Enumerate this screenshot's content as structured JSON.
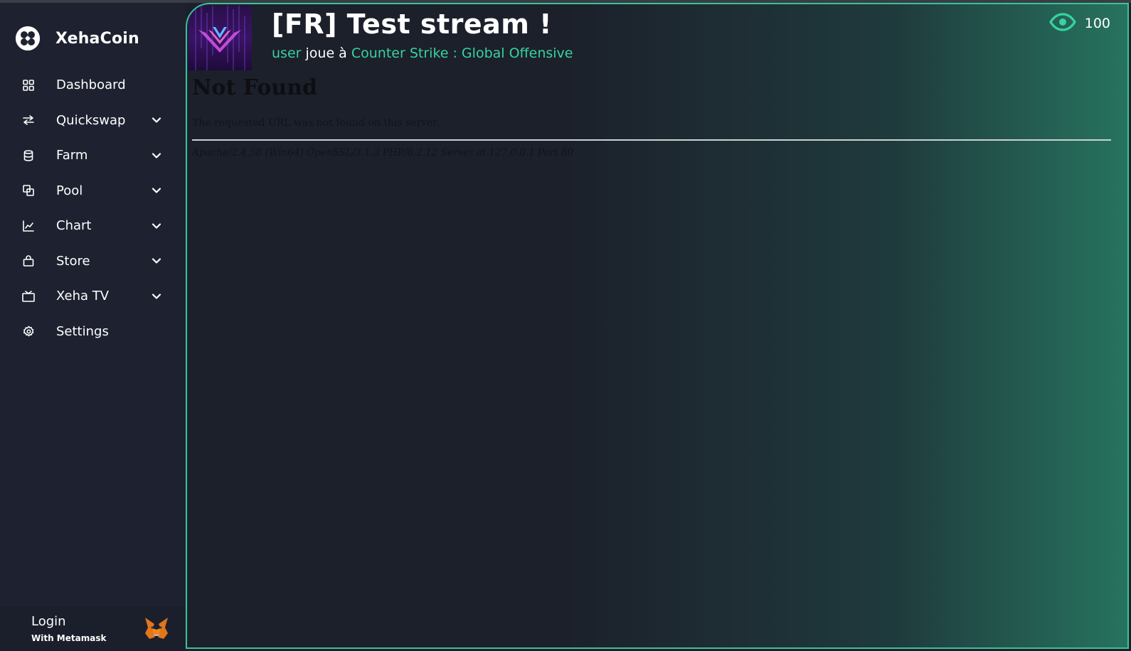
{
  "brand": {
    "name": "XehaCoin",
    "icon": "xehacoin-logo-icon"
  },
  "sidebar": {
    "items": [
      {
        "label": "Dashboard",
        "icon": "grid-icon",
        "has_submenu": false
      },
      {
        "label": "Quickswap",
        "icon": "swap-arrows-icon",
        "has_submenu": true
      },
      {
        "label": "Farm",
        "icon": "database-icon",
        "has_submenu": true
      },
      {
        "label": "Pool",
        "icon": "layers-icon",
        "has_submenu": true
      },
      {
        "label": "Chart",
        "icon": "line-chart-icon",
        "has_submenu": true
      },
      {
        "label": "Store",
        "icon": "shopping-bag-icon",
        "has_submenu": true
      },
      {
        "label": "Xeha TV",
        "icon": "tv-icon",
        "has_submenu": true
      },
      {
        "label": "Settings",
        "icon": "gear-icon",
        "has_submenu": false
      }
    ],
    "login": {
      "title": "Login",
      "subtitle": "With Metamask",
      "icon": "metamask-fox-icon"
    }
  },
  "stream": {
    "title": "[FR] Test stream !",
    "user": "user",
    "plays_text": "joue à",
    "game": "Counter Strike : Global Offensive",
    "viewers": "100",
    "viewers_icon": "eye-icon"
  },
  "error_page": {
    "heading": "Not Found",
    "message": "The requested URL was not found on this server.",
    "signature": "Apache/2.4.58 (Win64) OpenSSL/3.1.3 PHP/8.2.12 Server at 127.0.0.1 Port 80"
  },
  "colors": {
    "accent": "#37d3a0",
    "sidebar_bg": "#1e2230",
    "main_bg": "#1c202b"
  }
}
